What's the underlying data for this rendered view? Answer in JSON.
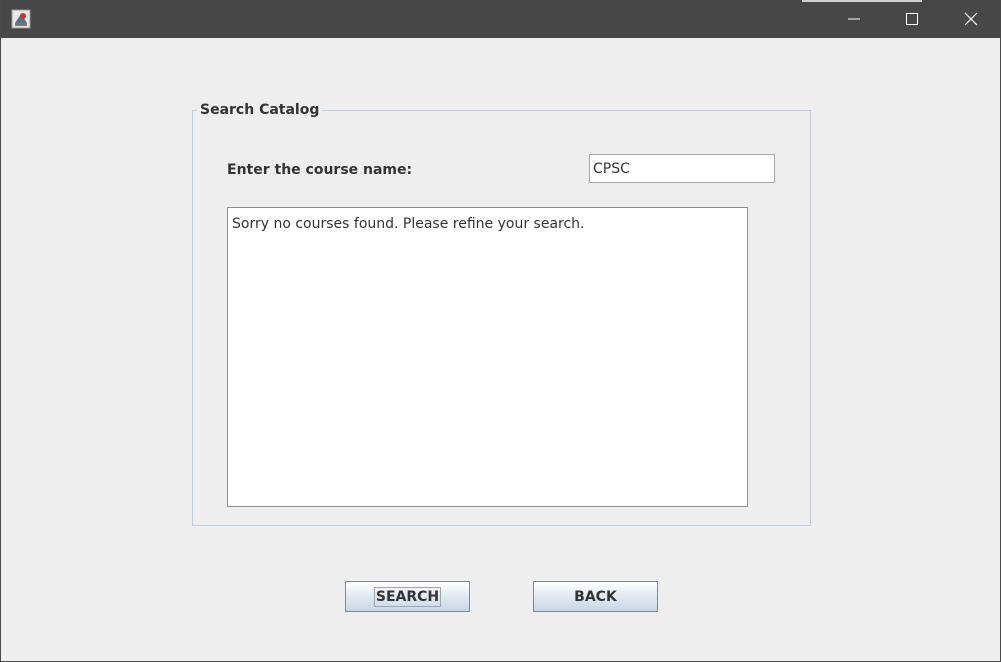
{
  "window": {
    "icon": "java-app-icon",
    "controls": {
      "minimize_icon": "minimize-icon",
      "maximize_icon": "maximize-icon",
      "close_icon": "close-icon"
    }
  },
  "search_panel": {
    "legend": "Search Catalog",
    "course_label": "Enter the course name:",
    "course_input_value": "CPSC",
    "results_text": "Sorry no courses found. Please refine your search."
  },
  "buttons": {
    "search_label": "SEARCH",
    "back_label": "BACK"
  },
  "colors": {
    "titlebar": "#474747",
    "panel_border": "#b8cfe5",
    "background": "#eeeeee"
  }
}
